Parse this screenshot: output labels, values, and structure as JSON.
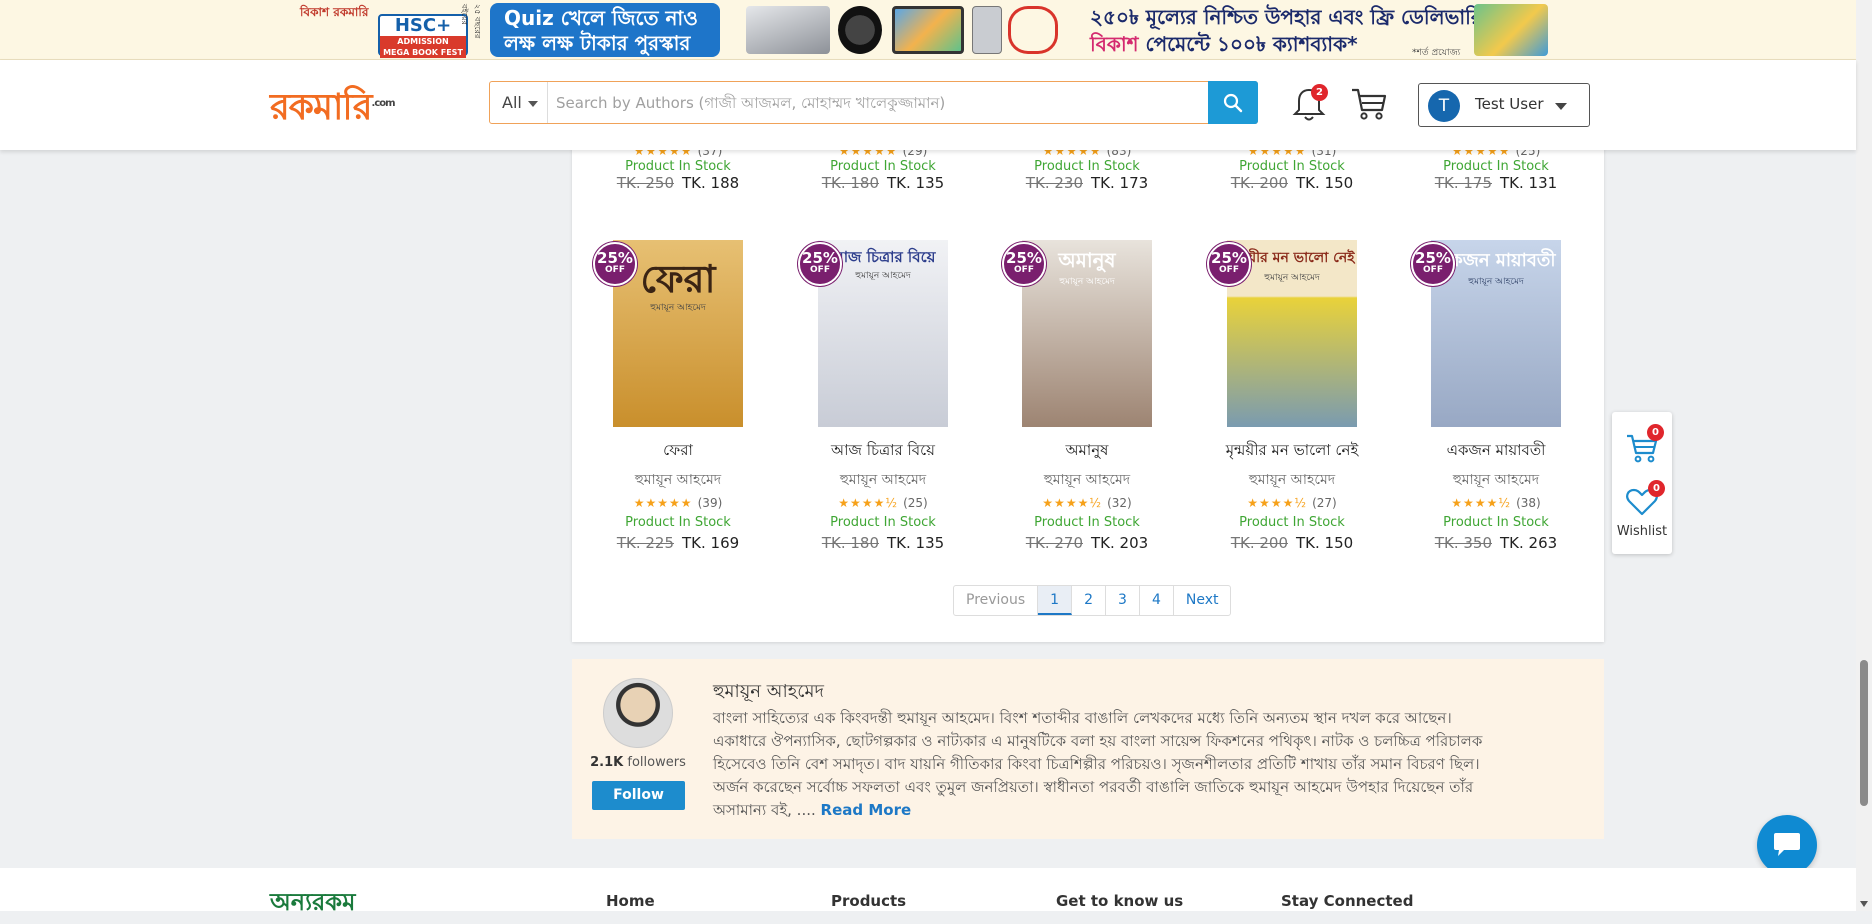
{
  "promo": {
    "brand_text": "বিকাশ রকমারি",
    "hsc_line1": "HSC+",
    "hsc_line2": "ADMISSION",
    "hsc_line3": "MEGA BOOK FEST",
    "side_text": "২৫ বছরের বইয়ের",
    "quiz_line1": "Quiz খেলে জিতে নাও",
    "quiz_line2": "লক্ষ লক্ষ টাকার পুরস্কার",
    "offer_line1": "২৫০৳ মূল্যের নিশ্চিত উপহার এবং ফ্রি ডেলিভারি",
    "offer_line2_brand": "বিকাশ",
    "offer_line2": "পেমেন্টে ১০০৳ ক্যাশব্যাক*",
    "note": "*শর্ত প্রযোজ্য"
  },
  "header": {
    "logo": "রকমারি",
    "logo_suffix": ".com",
    "search_category": "All",
    "search_placeholder": "Search by Authors (গাজী আজমল, মোহাম্মদ খালেকুজ্জামান)",
    "notification_count": "2",
    "user_initial": "T",
    "user_name": "Test User"
  },
  "previous_row": [
    {
      "rating_count": "(37)",
      "stock": "Product In Stock",
      "old_price": "TK. 250",
      "price": "TK. 188"
    },
    {
      "rating_count": "(29)",
      "stock": "Product In Stock",
      "old_price": "TK. 180",
      "price": "TK. 135"
    },
    {
      "rating_count": "(83)",
      "stock": "Product In Stock",
      "old_price": "TK. 230",
      "price": "TK. 173"
    },
    {
      "rating_count": "(31)",
      "stock": "Product In Stock",
      "old_price": "TK. 200",
      "price": "TK. 150"
    },
    {
      "rating_count": "(25)",
      "stock": "Product In Stock",
      "old_price": "TK. 175",
      "price": "TK. 131"
    }
  ],
  "products": [
    {
      "cover_title": "ফেরা",
      "cover_author": "হুমায়ূন আহমেদ",
      "discount": "25%",
      "discount_label": "OFF",
      "title": "ফেরা",
      "author": "হুমায়ূন আহমেদ",
      "stars": "★★★★★",
      "rating_count": "(39)",
      "stock": "Product In Stock",
      "old_price": "TK. 225",
      "price": "TK. 169",
      "cover_color": "#d9a441"
    },
    {
      "cover_title": "আজ চিত্রার বিয়ে",
      "cover_author": "হুমায়ূন আহমেদ",
      "discount": "25%",
      "discount_label": "OFF",
      "title": "আজ চিত্রার বিয়ে",
      "author": "হুমায়ূন আহমেদ",
      "stars": "★★★★½",
      "rating_count": "(25)",
      "stock": "Product In Stock",
      "old_price": "TK. 180",
      "price": "TK. 135",
      "cover_color": "#dfe3ea"
    },
    {
      "cover_title": "অমানুষ",
      "cover_author": "হুমায়ূন আহমেদ",
      "discount": "25%",
      "discount_label": "OFF",
      "title": "অমানুষ",
      "author": "হুমায়ূন আহমেদ",
      "stars": "★★★★½",
      "rating_count": "(32)",
      "stock": "Product In Stock",
      "old_price": "TK. 270",
      "price": "TK. 203",
      "cover_color": "#c9b7a8"
    },
    {
      "cover_title": "মৃন্ময়ীর মন ভালো নেই",
      "cover_author": "হুমায়ূন আহমেদ",
      "discount": "25%",
      "discount_label": "OFF",
      "title": "মৃন্ময়ীর মন ভালো নেই",
      "author": "হুমায়ূন আহমেদ",
      "stars": "★★★★½",
      "rating_count": "(27)",
      "stock": "Product In Stock",
      "old_price": "TK. 200",
      "price": "TK. 150",
      "cover_color": "#e9d23a"
    },
    {
      "cover_title": "একজন মায়াবতী",
      "cover_author": "হুমায়ূন আহমেদ",
      "discount": "25%",
      "discount_label": "OFF",
      "title": "একজন মায়াবতী",
      "author": "হুমায়ূন আহমেদ",
      "stars": "★★★★½",
      "rating_count": "(38)",
      "stock": "Product In Stock",
      "old_price": "TK. 350",
      "price": "TK. 263",
      "cover_color": "#b9c6dc"
    }
  ],
  "pagination": {
    "previous": "Previous",
    "pages": [
      "1",
      "2",
      "3",
      "4"
    ],
    "current": "1",
    "next": "Next"
  },
  "author": {
    "name": "হুমায়ূন আহমেদ",
    "followers_count": "2.1K",
    "followers_label": "followers",
    "follow_label": "Follow",
    "bio": "বাংলা সাহিত্যের এক কিংবদন্তী হুমায়ূন আহমেদ। বিংশ শতাব্দীর বাঙালি লেখকদের মধ্যে তিনি অন্যতম স্থান দখল করে আছেন। একাধারে ঔপন্যাসিক, ছোটগল্পকার ও নাট্যকার এ মানুষটিকে বলা হয় বাংলা সায়েন্স ফিকশনের পথিকৃৎ। নাটক ও চলচ্চিত্র পরিচালক হিসেবেও তিনি বেশ সমাদৃত। বাদ যায়নি গীতিকার কিংবা চিত্রশিল্পীর পরিচয়ও। সৃজনশীলতার প্রতিটি শাখায় তাঁর সমান বিচরণ ছিল। অর্জন করেছেন সর্বোচ্চ সফলতা এবং তুমুল জনপ্রিয়তা। স্বাধীনতা পরবর্তী বাঙালি জাতিকে হুমায়ূন আহমেদ উপহার দিয়েছেন তাঁর অসামান্য বই, ....",
    "read_more": "Read More"
  },
  "side_widget": {
    "cart_count": "0",
    "wishlist_count": "0",
    "wishlist_label": "Wishlist"
  },
  "footer": {
    "logo": "অন্যরকম",
    "links": [
      "Home",
      "Products",
      "Get to know us",
      "Stay Connected"
    ]
  },
  "colors": {
    "accent": "#1d9ad6",
    "stock_green": "#3fa634",
    "star_orange": "#f6a11a",
    "discount_purple": "#7a1f6e"
  }
}
